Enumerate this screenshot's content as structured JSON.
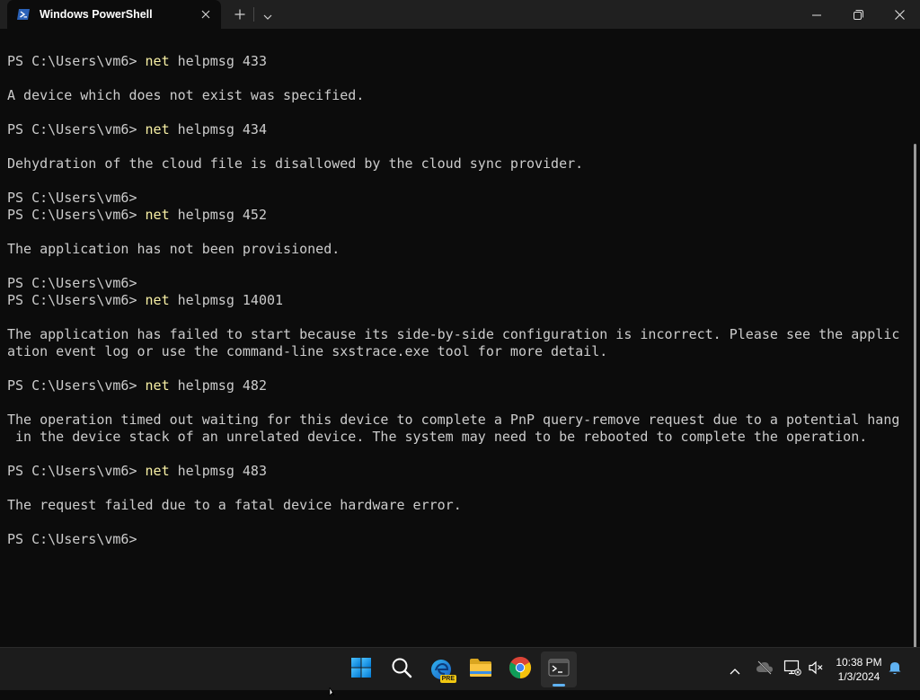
{
  "window": {
    "tab_title": "Windows PowerShell",
    "tab_icon": "powershell-icon",
    "new_tab_icon": "plus-icon",
    "dropdown_icon": "chevron-down-icon"
  },
  "terminal": {
    "lines": [
      {
        "prompt": "PS C:\\Users\\vm6> ",
        "kw": "net",
        "rest": " helpmsg 433"
      },
      {
        "text": ""
      },
      {
        "text": "A device which does not exist was specified."
      },
      {
        "text": ""
      },
      {
        "prompt": "PS C:\\Users\\vm6> ",
        "kw": "net",
        "rest": " helpmsg 434"
      },
      {
        "text": ""
      },
      {
        "text": "Dehydration of the cloud file is disallowed by the cloud sync provider."
      },
      {
        "text": ""
      },
      {
        "prompt": "PS C:\\Users\\vm6>"
      },
      {
        "prompt": "PS C:\\Users\\vm6> ",
        "kw": "net",
        "rest": " helpmsg 452"
      },
      {
        "text": ""
      },
      {
        "text": "The application has not been provisioned."
      },
      {
        "text": ""
      },
      {
        "prompt": "PS C:\\Users\\vm6>"
      },
      {
        "prompt": "PS C:\\Users\\vm6> ",
        "kw": "net",
        "rest": " helpmsg 14001"
      },
      {
        "text": ""
      },
      {
        "text": "The application has failed to start because its side-by-side configuration is incorrect. Please see the applic"
      },
      {
        "text": "ation event log or use the command-line sxstrace.exe tool for more detail."
      },
      {
        "text": ""
      },
      {
        "prompt": "PS C:\\Users\\vm6> ",
        "kw": "net",
        "rest": " helpmsg 482"
      },
      {
        "text": ""
      },
      {
        "text": "The operation timed out waiting for this device to complete a PnP query-remove request due to a potential hang"
      },
      {
        "text": " in the device stack of an unrelated device. The system may need to be rebooted to complete the operation."
      },
      {
        "text": ""
      },
      {
        "prompt": "PS C:\\Users\\vm6> ",
        "kw": "net",
        "rest": " helpmsg 483"
      },
      {
        "text": ""
      },
      {
        "text": "The request failed due to a fatal device hardware error."
      },
      {
        "text": ""
      },
      {
        "prompt": "PS C:\\Users\\vm6>"
      }
    ]
  },
  "taskbar": {
    "apps": [
      {
        "name": "start-button",
        "icon": "windows-logo-icon"
      },
      {
        "name": "search-button",
        "icon": "search-icon"
      },
      {
        "name": "edge-preview-app",
        "icon": "edge-beta-icon",
        "badge": "PRE"
      },
      {
        "name": "file-explorer-app",
        "icon": "folder-icon"
      },
      {
        "name": "chrome-app",
        "icon": "chrome-icon"
      },
      {
        "name": "terminal-app",
        "icon": "terminal-icon",
        "active": true
      }
    ],
    "tray": {
      "chevron_icon": "chevron-up-icon",
      "onedrive_icon": "cloud-offline-icon",
      "network_icon": "network-icon",
      "volume_icon": "volume-muted-icon",
      "notification_icon": "bell-icon"
    },
    "clock": {
      "time": "10:38 PM",
      "date": "1/3/2024"
    }
  }
}
